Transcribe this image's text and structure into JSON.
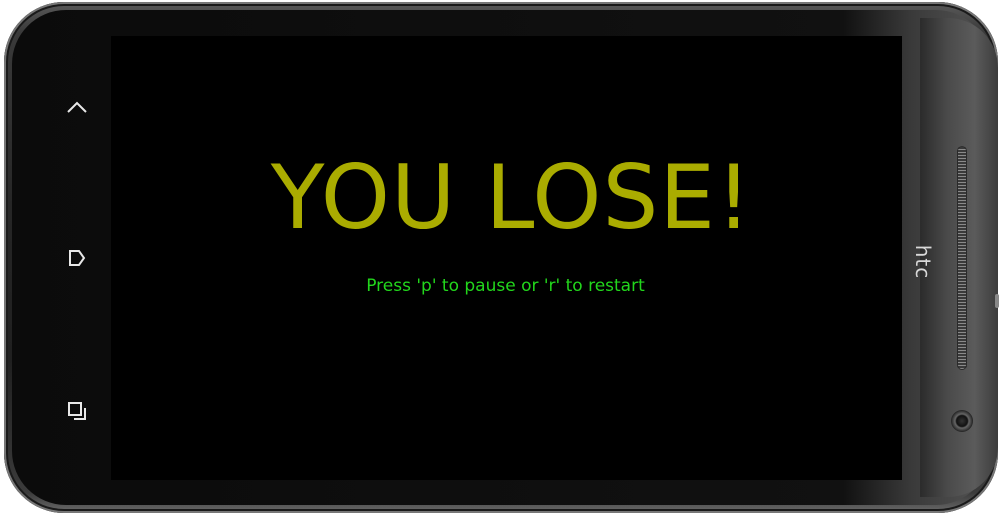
{
  "game": {
    "title_text": "YOU LOSE!",
    "hint_text": "Press 'p' to pause or 'r' to restart"
  },
  "device": {
    "brand": "htc",
    "nav_buttons": [
      {
        "icon": "up-chevron-icon"
      },
      {
        "icon": "home-icon"
      },
      {
        "icon": "recent-apps-icon"
      }
    ]
  },
  "colors": {
    "title": "#aaac00",
    "hint": "#22d61c",
    "screen_bg": "#000000"
  }
}
